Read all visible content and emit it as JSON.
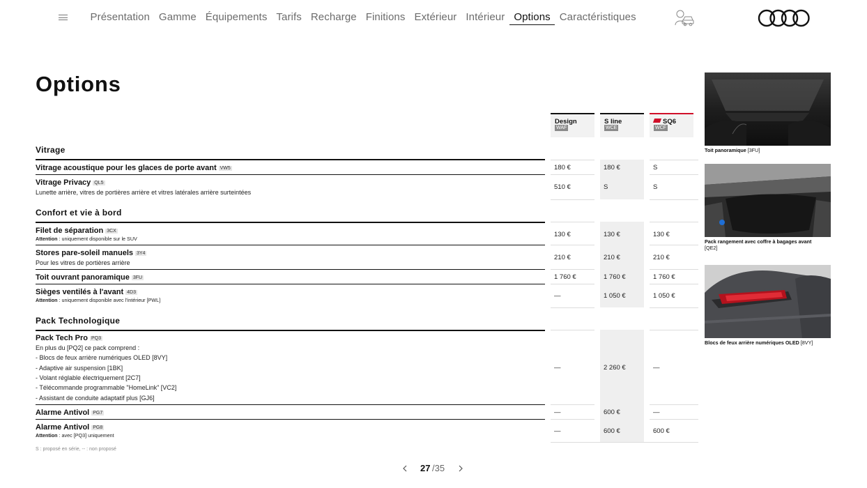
{
  "nav": {
    "items": [
      "Présentation",
      "Gamme",
      "Équipements",
      "Tarifs",
      "Recharge",
      "Finitions",
      "Extérieur",
      "Intérieur",
      "Options",
      "Caractéristiques"
    ],
    "active": "Options"
  },
  "page_title": "Options",
  "columns": [
    {
      "name": "Design",
      "code": "WAF"
    },
    {
      "name": "S line",
      "code": "WCE"
    },
    {
      "name": "SQ6",
      "code": "WCF"
    }
  ],
  "sections": {
    "vitrage": "Vitrage",
    "confort": "Confort et vie à bord",
    "tech": "Pack Technologique"
  },
  "rows": {
    "r1": {
      "title": "Vitrage acoustique pour les glaces de porte avant",
      "code": "VW5",
      "values": [
        "180 €",
        "180 €",
        "S"
      ]
    },
    "r2": {
      "title": "Vitrage Privacy",
      "code": "QL5",
      "desc": "Lunette arrière, vitres de portières arrière et vitres latérales arrière surteintées",
      "values": [
        "510 €",
        "S",
        "S"
      ]
    },
    "r3": {
      "title": "Filet de séparation",
      "code": "3CX",
      "note_label": "Attention",
      "note_text": " : uniquement disponible sur le SUV",
      "values": [
        "130 €",
        "130 €",
        "130 €"
      ]
    },
    "r4": {
      "title": "Stores pare-soleil manuels",
      "code": "3Y4",
      "desc": "Pour les vitres de portières arrière",
      "values": [
        "210 €",
        "210 €",
        "210 €"
      ]
    },
    "r5": {
      "title": "Toit ouvrant panoramique",
      "code": "3FU",
      "values": [
        "1 760 €",
        "1 760 €",
        "1 760 €"
      ]
    },
    "r6": {
      "title": "Sièges ventilés à l'avant",
      "code": "4D3",
      "note_label": "Attention",
      "note_text": " : uniquement disponible avec l'intérieur [PWL]",
      "values": [
        "—",
        "1 050 €",
        "1 050 €"
      ]
    },
    "r7": {
      "title": "Pack Tech Pro",
      "code": "PQ3",
      "lines": [
        "En plus du [PQ2] ce pack comprend :",
        "- Blocs de feux arrière numériques OLED [8VY]",
        "- Adaptive air suspension [1BK]",
        "- Volant réglable électriquement [2C7]",
        "- Télécommande programmable \"HomeLink\" [VC2]",
        "- Assistant de conduite adaptatif plus [GJ6]"
      ],
      "values": [
        "—",
        "2 260 €",
        "—"
      ]
    },
    "r8": {
      "title": "Alarme Antivol",
      "code": "PG7",
      "values": [
        "—",
        "600 €",
        "—"
      ]
    },
    "r9": {
      "title": "Alarme Antivol",
      "code": "PG8",
      "note_label": "Attention",
      "note_text": " : avec [PQ3] uniquement",
      "values": [
        "—",
        "600 €",
        "600 €"
      ]
    }
  },
  "footnote": "S : proposé en série, -- : non proposé",
  "pagination": {
    "current": "27",
    "total": "/35"
  },
  "images": [
    {
      "title": "Toit panoramique",
      "code": " [3FU]"
    },
    {
      "title": "Pack rangement avec coffre à bagages avant",
      "code": "[QE2]"
    },
    {
      "title": "Blocs de feux arrière numériques OLED",
      "code": " [8VY]"
    }
  ]
}
